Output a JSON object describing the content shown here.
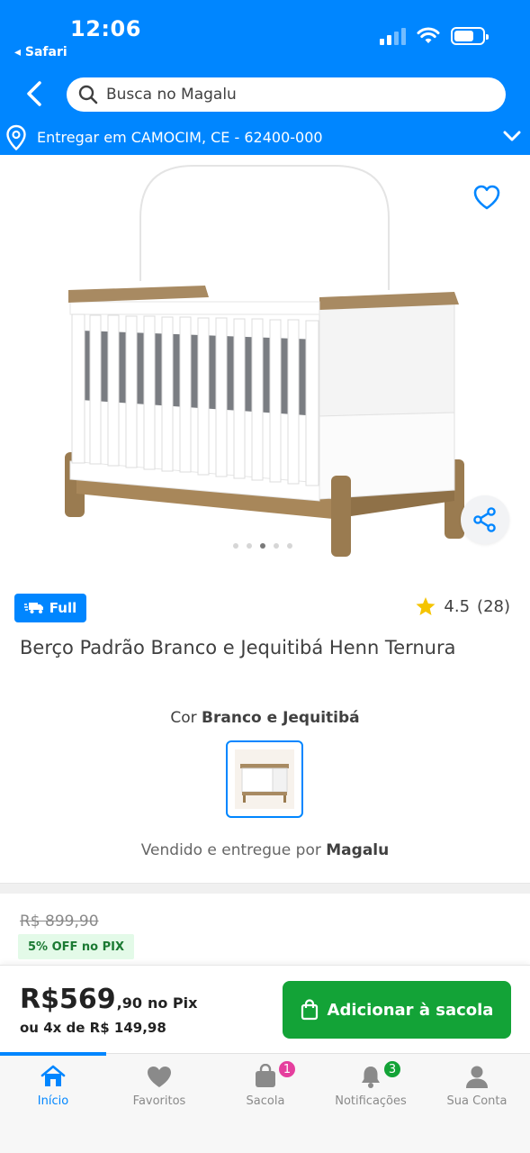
{
  "status_bar": {
    "time": "12:06",
    "back_app": "◂ Safari"
  },
  "search": {
    "placeholder": "Busca no Magalu"
  },
  "delivery": {
    "text": "Entregar em CAMOCIM, CE - 62400-000"
  },
  "gallery": {
    "dots": 5,
    "active_index": 2
  },
  "product": {
    "badge": "Full",
    "rating": "4.5",
    "rating_count": "(28)",
    "title": "Berço Padrão Branco e Jequitibá Henn Ternura",
    "color_label": "Cor",
    "color_value": "Branco e Jequitibá",
    "seller_prefix": "Vendido e entregue por",
    "seller_name": "Magalu"
  },
  "pricing": {
    "old_price": "R$ 899,90",
    "pix_discount": "5% OFF no PIX",
    "price_int": "R$569",
    "price_cents": ",90",
    "price_suffix": "no Pix",
    "installments": "ou 4x de R$ 149,98"
  },
  "actions": {
    "add_to_bag": "Adicionar à sacola"
  },
  "tabs": [
    {
      "label": "Início",
      "icon": "home-icon"
    },
    {
      "label": "Favoritos",
      "icon": "heart-icon"
    },
    {
      "label": "Sacola",
      "icon": "bag-icon",
      "badge": "1"
    },
    {
      "label": "Notificações",
      "icon": "bell-icon",
      "badge": "3"
    },
    {
      "label": "Sua Conta",
      "icon": "user-icon"
    }
  ],
  "colors": {
    "brand_blue": "#0086ff",
    "cta_green": "#13a337",
    "badge_pink": "#e53f9e"
  }
}
